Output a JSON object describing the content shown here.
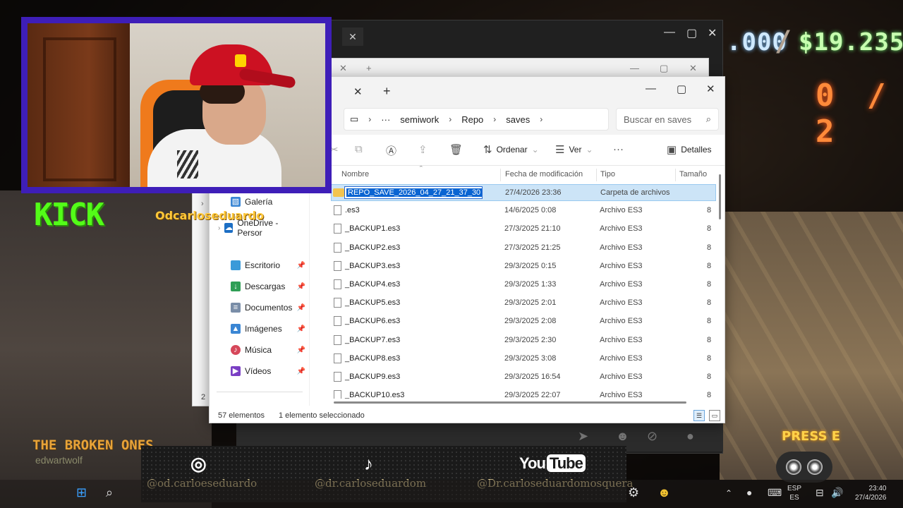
{
  "hud": {
    "money_left": ".000",
    "money_right": "$19.235",
    "count": "0 / 2",
    "press": "PRESS E"
  },
  "stream": {
    "platform": "KICK",
    "handle": "Odcarloseduardo",
    "overlay_title": "THE BROKEN ONES",
    "overlay_sub": "edwartwolf"
  },
  "socials": {
    "instagram": "@od.carloeseduardo",
    "tiktok": "@dr.carloseduardom",
    "youtube_logo_a": "You",
    "youtube_logo_b": "Tube",
    "youtube": "@Dr.carloseduardomosquera"
  },
  "explorer": {
    "breadcrumb": [
      "semiwork",
      "Repo",
      "saves"
    ],
    "search_placeholder": "Buscar en saves",
    "toolbar": {
      "sort": "Ordenar",
      "view": "Ver",
      "details": "Detalles"
    },
    "sidebar": {
      "top": [
        {
          "label": "Galería"
        },
        {
          "label": "OneDrive - Persor"
        }
      ],
      "pinned": [
        {
          "label": "Escritorio",
          "icon": "desktop-icon",
          "color": "#3a9ad9"
        },
        {
          "label": "Descargas",
          "icon": "download-icon",
          "color": "#2e9e55"
        },
        {
          "label": "Documentos",
          "icon": "documents-icon",
          "color": "#7a8ea8"
        },
        {
          "label": "Imágenes",
          "icon": "pictures-icon",
          "color": "#3a86d4"
        },
        {
          "label": "Música",
          "icon": "music-icon",
          "color": "#d6475a"
        },
        {
          "label": "Vídeos",
          "icon": "videos-icon",
          "color": "#7a3fc4"
        }
      ]
    },
    "columns": {
      "name": "Nombre",
      "date": "Fecha de modificación",
      "type": "Tipo",
      "size": "Tamaño"
    },
    "rename_value": "REPO_SAVE_2026_04_27_21_37_30",
    "rows": [
      {
        "name": "REPO_SAVE_2026_04_27_21_37_30",
        "date": "27/4/2026 23:36",
        "type": "Carpeta de archivos",
        "size": "",
        "folder": true,
        "selected": true
      },
      {
        "name": ".es3",
        "date": "14/6/2025 0:08",
        "type": "Archivo ES3",
        "size": "8"
      },
      {
        "name": "_BACKUP1.es3",
        "date": "27/3/2025 21:10",
        "type": "Archivo ES3",
        "size": "8"
      },
      {
        "name": "_BACKUP2.es3",
        "date": "27/3/2025 21:25",
        "type": "Archivo ES3",
        "size": "8"
      },
      {
        "name": "_BACKUP3.es3",
        "date": "29/3/2025 0:15",
        "type": "Archivo ES3",
        "size": "8"
      },
      {
        "name": "_BACKUP4.es3",
        "date": "29/3/2025 1:33",
        "type": "Archivo ES3",
        "size": "8"
      },
      {
        "name": "_BACKUP5.es3",
        "date": "29/3/2025 2:01",
        "type": "Archivo ES3",
        "size": "8"
      },
      {
        "name": "_BACKUP6.es3",
        "date": "29/3/2025 2:08",
        "type": "Archivo ES3",
        "size": "8"
      },
      {
        "name": "_BACKUP7.es3",
        "date": "29/3/2025 2:30",
        "type": "Archivo ES3",
        "size": "8"
      },
      {
        "name": "_BACKUP8.es3",
        "date": "29/3/2025 3:08",
        "type": "Archivo ES3",
        "size": "8"
      },
      {
        "name": "_BACKUP9.es3",
        "date": "29/3/2025 16:54",
        "type": "Archivo ES3",
        "size": "8"
      },
      {
        "name": "_BACKUP10.es3",
        "date": "29/3/2025 22:07",
        "type": "Archivo ES3",
        "size": "8"
      }
    ],
    "status_count": "57 elementos",
    "status_selected": "1 elemento seleccionado",
    "left_edge_text": "2"
  },
  "taskbar": {
    "lang": "ESP",
    "lang_sub": "ES",
    "time": "23:40",
    "date": "27/4/2026"
  }
}
